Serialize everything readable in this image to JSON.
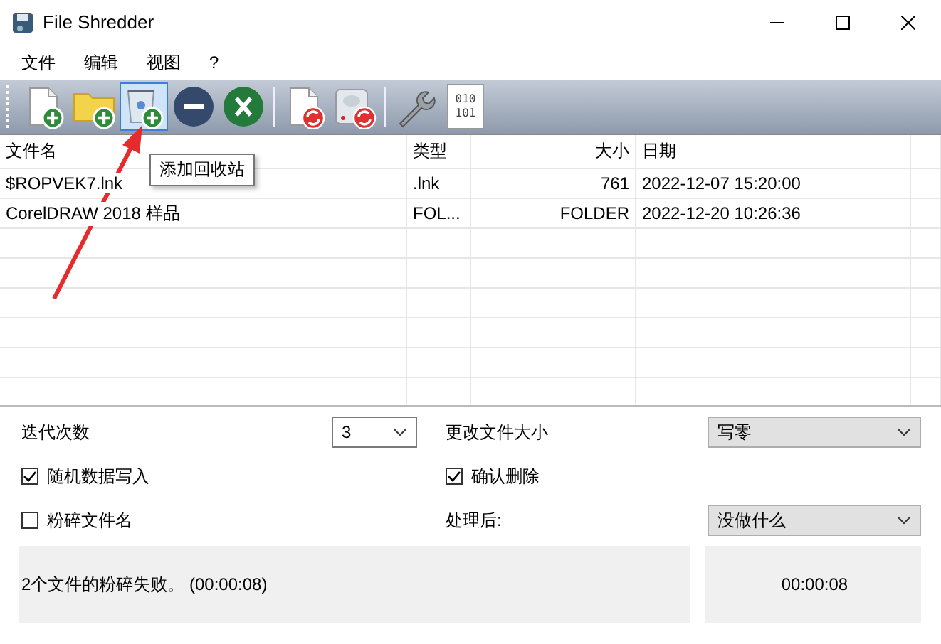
{
  "window": {
    "title": "File Shredder"
  },
  "menu": [
    "文件",
    "编辑",
    "视图",
    "?"
  ],
  "toolbar": [
    {
      "kind": "file-add",
      "selected": false
    },
    {
      "kind": "folder-add",
      "selected": false
    },
    {
      "kind": "bin-add",
      "selected": true
    },
    {
      "kind": "remove",
      "selected": false
    },
    {
      "kind": "clear",
      "selected": false
    },
    {
      "kind": "sep"
    },
    {
      "kind": "file-refresh",
      "selected": false
    },
    {
      "kind": "disk-refresh",
      "selected": false
    },
    {
      "kind": "sep"
    },
    {
      "kind": "wrench",
      "selected": false
    },
    {
      "kind": "binary",
      "selected": false,
      "lines": [
        "010",
        "101"
      ]
    }
  ],
  "tooltip": "添加回收站",
  "table": {
    "columns": [
      "文件名",
      "类型",
      "大小",
      "日期"
    ],
    "rows": [
      [
        "$ROPVEK7.lnk",
        ".lnk",
        "761",
        "2022-12-07 15:20:00"
      ],
      [
        "CorelDRAW 2018 样品",
        "FOL...",
        "FOLDER",
        "2022-12-20 10:26:36"
      ]
    ]
  },
  "options": [
    {
      "kind": "label",
      "text": "迭代次数"
    },
    {
      "kind": "edit-combo",
      "value": "3"
    },
    {
      "kind": "label",
      "text": "更改文件大小"
    },
    {
      "kind": "combo",
      "value": "写零"
    },
    {
      "kind": "check",
      "text": "随机数据写入",
      "checked": true
    },
    {
      "kind": "blank"
    },
    {
      "kind": "check",
      "text": "确认删除",
      "checked": true
    },
    {
      "kind": "blank"
    },
    {
      "kind": "check",
      "text": "粉碎文件名",
      "checked": false
    },
    {
      "kind": "blank"
    },
    {
      "kind": "label",
      "text": "处理后:"
    },
    {
      "kind": "combo",
      "value": "没做什么"
    }
  ],
  "status": {
    "message": "2个文件的粉碎失败。 (00:00:08)",
    "time": "00:00:08"
  }
}
